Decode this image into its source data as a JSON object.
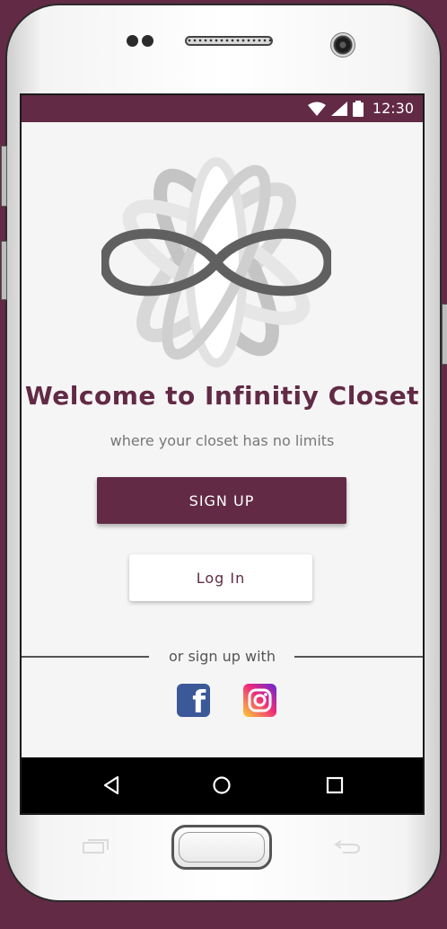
{
  "status_bar": {
    "time": "12:30",
    "background": "#622a45",
    "icons": [
      "wifi-icon",
      "signal-icon",
      "battery-icon"
    ]
  },
  "app": {
    "title": "Welcome to Infinitiy Closet",
    "subtitle": "where your closet has no limits",
    "brand_color": "#622a45",
    "logo": "infinity-flower-logo"
  },
  "buttons": {
    "signup_label": "SIGN UP",
    "login_label": "Log In"
  },
  "social": {
    "divider_text": "or sign up with",
    "facebook_icon": "facebook-icon",
    "facebook_letter": "f",
    "instagram_icon": "instagram-icon"
  },
  "nav_bar": {
    "items": [
      "back-icon",
      "home-icon",
      "recents-icon"
    ]
  }
}
